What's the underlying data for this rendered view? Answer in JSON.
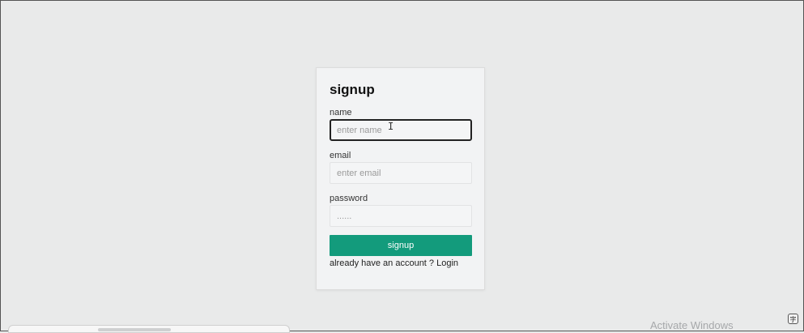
{
  "signup": {
    "title": "signup",
    "name_label": "name",
    "name_placeholder": "enter name",
    "email_label": "email",
    "email_placeholder": "enter email",
    "password_label": "password",
    "password_placeholder": "......",
    "button_label": "signup",
    "footer_text": "already have an account ?",
    "login_link": "Login"
  },
  "desktop": {
    "activate_watermark": "Activate Windows"
  },
  "colors": {
    "accent": "#139b7c",
    "page_bg": "#e9eaea",
    "card_bg": "#f2f3f4"
  },
  "icons": {
    "cursor": "ibeam-cursor-icon",
    "tray": "translate-icon"
  }
}
